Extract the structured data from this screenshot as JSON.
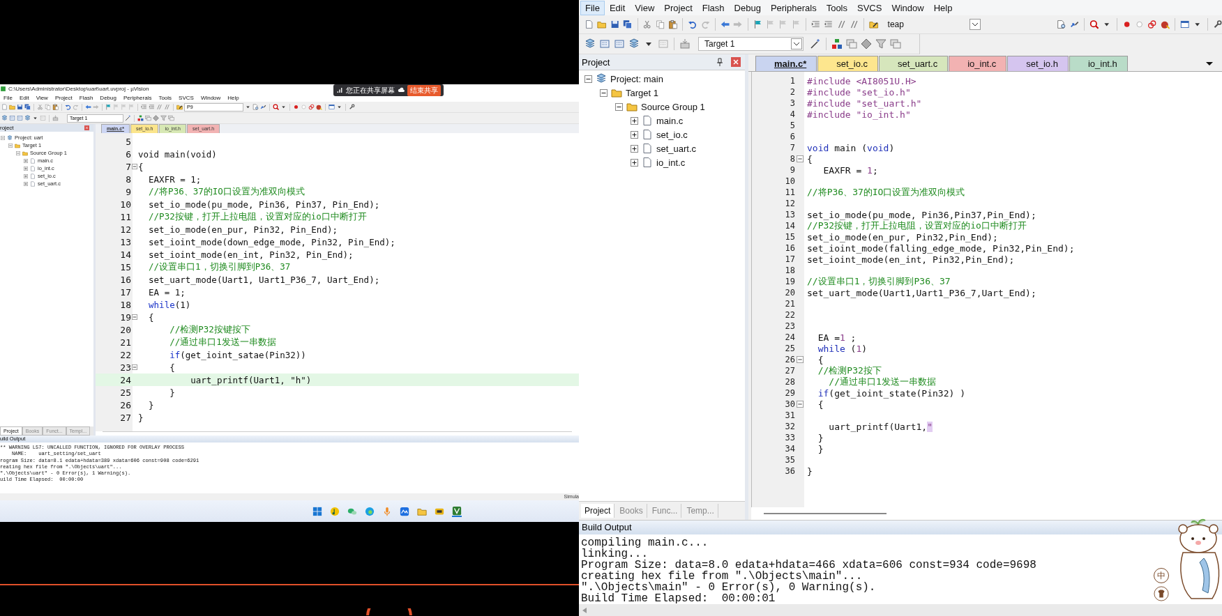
{
  "screen_share": {
    "window_title": "C:\\Users\\Administrator\\Desktop\\uart\\uart.uvproj - µVision",
    "share_banner": {
      "text": "您正在共享屏幕",
      "button": "结束共享"
    },
    "menu": [
      {
        "label": "File"
      },
      {
        "label": "Edit"
      },
      {
        "label": "View"
      },
      {
        "label": "Project"
      },
      {
        "label": "Flash"
      },
      {
        "label": "Debug"
      },
      {
        "label": "Peripherals"
      },
      {
        "label": "Tools"
      },
      {
        "label": "SVCS"
      },
      {
        "label": "Window"
      },
      {
        "label": "Help"
      }
    ],
    "toolbar": {
      "find_combo": "P9",
      "target_combo": "Target 1"
    },
    "project_panel": {
      "title": "roject",
      "tree": [
        {
          "label": "Project: uart",
          "expanded": true,
          "children": [
            {
              "label": "Target 1",
              "expanded": true,
              "children": [
                {
                  "label": "Source Group 1",
                  "expanded": true,
                  "children": [
                    {
                      "label": "main.c",
                      "expanded": false
                    },
                    {
                      "label": "io_int.c",
                      "expanded": false
                    },
                    {
                      "label": "set_io.c",
                      "expanded": false
                    },
                    {
                      "label": "set_uart.c",
                      "expanded": false
                    }
                  ]
                }
              ]
            }
          ]
        }
      ]
    },
    "editor_tabs": [
      {
        "label": "main.c*",
        "selected": true,
        "color": "#cdd6f4"
      },
      {
        "label": "set_io.h",
        "selected": false,
        "color": "#fbe58c"
      },
      {
        "label": "io_int.h",
        "selected": false,
        "color": "#d7e8b4"
      },
      {
        "label": "set_uart.h",
        "selected": false,
        "color": "#f2b3b3"
      }
    ],
    "code": [
      {
        "n": "5",
        "fold": false,
        "current": false
      },
      {
        "n": "6",
        "fold": false,
        "current": false,
        "tokens": [
          {
            "text": "void main(void)",
            "kind": "tx"
          }
        ]
      },
      {
        "n": "7",
        "fold": true,
        "current": false,
        "tokens": [
          {
            "text": "{",
            "kind": "tx"
          }
        ]
      },
      {
        "n": "8",
        "fold": false,
        "current": false,
        "tokens": [
          {
            "text": "  EAXFR = 1;",
            "kind": "tx"
          }
        ]
      },
      {
        "n": "9",
        "fold": false,
        "current": false,
        "tokens": [
          {
            "text": "  //将P36、37的IO口设置为准双向模式",
            "kind": "cm"
          }
        ]
      },
      {
        "n": "10",
        "fold": false,
        "current": false,
        "tokens": [
          {
            "text": "  set_io_mode(pu_mode, Pin36, Pin37, Pin_End);",
            "kind": "tx"
          }
        ]
      },
      {
        "n": "11",
        "fold": false,
        "current": false,
        "tokens": [
          {
            "text": "  //P32按键，打开上拉电阻，设置对应的io口中断打开",
            "kind": "cm"
          }
        ]
      },
      {
        "n": "12",
        "fold": false,
        "current": false,
        "tokens": [
          {
            "text": "  set_io_mode(en_pur, Pin32, Pin_End);",
            "kind": "tx"
          }
        ]
      },
      {
        "n": "13",
        "fold": false,
        "current": false,
        "tokens": [
          {
            "text": "  set_ioint_mode(down_edge_mode, Pin32, Pin_End);",
            "kind": "tx"
          }
        ]
      },
      {
        "n": "14",
        "fold": false,
        "current": false,
        "tokens": [
          {
            "text": "  set_ioint_mode(en_int, Pin32, Pin_End);",
            "kind": "tx"
          }
        ]
      },
      {
        "n": "15",
        "fold": false,
        "current": false,
        "tokens": [
          {
            "text": "  //设置串口1，切换引脚到P36、37",
            "kind": "cm"
          }
        ]
      },
      {
        "n": "16",
        "fold": false,
        "current": false,
        "tokens": [
          {
            "text": "  set_uart_mode(Uart1, Uart1_P36_7, Uart_End);",
            "kind": "tx"
          }
        ]
      },
      {
        "n": "17",
        "fold": false,
        "current": false,
        "tokens": [
          {
            "text": "  EA = 1;",
            "kind": "tx"
          }
        ]
      },
      {
        "n": "18",
        "fold": false,
        "current": false,
        "tokens": [
          {
            "text": "  while",
            "kind": "kw"
          },
          {
            "text": "(1)",
            "kind": "tx"
          }
        ]
      },
      {
        "n": "19",
        "fold": true,
        "current": false,
        "tokens": [
          {
            "text": "  {",
            "kind": "tx"
          }
        ]
      },
      {
        "n": "20",
        "fold": false,
        "current": false,
        "tokens": [
          {
            "text": "      //检测P32按键按下",
            "kind": "cm"
          }
        ]
      },
      {
        "n": "21",
        "fold": false,
        "current": false,
        "tokens": [
          {
            "text": "      //通过串口1发送一串数据",
            "kind": "cm"
          }
        ]
      },
      {
        "n": "22",
        "fold": false,
        "current": false,
        "tokens": [
          {
            "text": "      if",
            "kind": "kw"
          },
          {
            "text": "(get_ioint_satae(Pin32))",
            "kind": "tx"
          }
        ]
      },
      {
        "n": "23",
        "fold": true,
        "current": false,
        "tokens": [
          {
            "text": "      {",
            "kind": "tx"
          }
        ]
      },
      {
        "n": "24",
        "fold": false,
        "current": true,
        "tokens": [
          {
            "text": "          uart_printf(Uart1, \"h\")",
            "kind": "tx"
          }
        ]
      },
      {
        "n": "25",
        "fold": false,
        "current": false,
        "tokens": [
          {
            "text": "      }",
            "kind": "tx"
          }
        ]
      },
      {
        "n": "26",
        "fold": false,
        "current": false,
        "tokens": [
          {
            "text": "  }",
            "kind": "tx"
          }
        ]
      },
      {
        "n": "27",
        "fold": false,
        "current": false,
        "tokens": [
          {
            "text": "}",
            "kind": "tx"
          }
        ]
      }
    ],
    "panel_tabs": [
      {
        "label": "Project",
        "selected": true
      },
      {
        "label": "Books",
        "selected": false
      },
      {
        "label": "Funct...",
        "selected": false
      },
      {
        "label": "Templ...",
        "selected": false
      }
    ],
    "build_output": {
      "title": "uild Output",
      "lines": [
        "** WARNING L57: UNCALLED FUNCTION, IGNORED FOR OVERLAY PROCESS",
        "    NAME:    uart_setting/set_uart",
        "rogram Size: data=8.1 edata+hdata=389 xdata=606 const=908 code=6291",
        "reating hex file from \".\\Objects\\uart\"...",
        "\".\\Objects\\uart\" - 0 Error(s), 1 Warning(s).",
        "uild Time Elapsed:  00:00:00"
      ]
    },
    "status_bar": "Simula"
  },
  "ide": {
    "menu": [
      {
        "label": "File",
        "selected": true
      },
      {
        "label": "Edit",
        "selected": false
      },
      {
        "label": "View",
        "selected": false
      },
      {
        "label": "Project",
        "selected": false
      },
      {
        "label": "Flash",
        "selected": false
      },
      {
        "label": "Debug",
        "selected": false
      },
      {
        "label": "Peripherals",
        "selected": false
      },
      {
        "label": "Tools",
        "selected": false
      },
      {
        "label": "SVCS",
        "selected": false
      },
      {
        "label": "Window",
        "selected": false
      },
      {
        "label": "Help",
        "selected": false
      }
    ],
    "toolbar": {
      "find_combo": "teap",
      "target_combo": "Target 1"
    },
    "project_panel": {
      "title": "Project",
      "tree": [
        {
          "label": "Project: main",
          "expanded": true,
          "children": [
            {
              "label": "Target 1",
              "expanded": true,
              "children": [
                {
                  "label": "Source Group 1",
                  "expanded": true,
                  "children": [
                    {
                      "label": "main.c",
                      "expanded": false
                    },
                    {
                      "label": "set_io.c",
                      "expanded": false
                    },
                    {
                      "label": "set_uart.c",
                      "expanded": false
                    },
                    {
                      "label": "io_int.c",
                      "expanded": false
                    }
                  ]
                }
              ]
            }
          ]
        }
      ]
    },
    "editor_tabs": [
      {
        "label": "main.c*",
        "selected": true,
        "color": "#c9d4f0"
      },
      {
        "label": "set_io.c",
        "selected": false,
        "color": "#fde68e"
      },
      {
        "label": "set_uart.c",
        "selected": false,
        "color": "#d6e6bc"
      },
      {
        "label": "io_int.c",
        "selected": false,
        "color": "#f2b2b2"
      },
      {
        "label": "set_io.h",
        "selected": false,
        "color": "#d5c5ef"
      },
      {
        "label": "io_int.h",
        "selected": false,
        "color": "#b9dcc8"
      }
    ],
    "code": [
      {
        "n": "1",
        "fold": false,
        "tokens": [
          {
            "text": "#include <AI8051U.H>",
            "kind": "pp"
          }
        ]
      },
      {
        "n": "2",
        "fold": false,
        "tokens": [
          {
            "text": "#include \"set_io.h\"",
            "kind": "pp"
          }
        ]
      },
      {
        "n": "3",
        "fold": false,
        "tokens": [
          {
            "text": "#include \"set_uart.h\"",
            "kind": "pp"
          }
        ]
      },
      {
        "n": "4",
        "fold": false,
        "tokens": [
          {
            "text": "#include \"io_int.h\"",
            "kind": "pp"
          }
        ]
      },
      {
        "n": "5",
        "fold": false
      },
      {
        "n": "6",
        "fold": false
      },
      {
        "n": "7",
        "fold": false,
        "tokens": [
          {
            "text": "void",
            "kind": "kw"
          },
          {
            "text": " main (",
            "kind": "tx"
          },
          {
            "text": "void",
            "kind": "kw"
          },
          {
            "text": ")",
            "kind": "tx"
          }
        ]
      },
      {
        "n": "8",
        "fold": true,
        "tokens": [
          {
            "text": "{",
            "kind": "tx"
          }
        ]
      },
      {
        "n": "9",
        "fold": false,
        "tokens": [
          {
            "text": "   EAXFR = ",
            "kind": "tx"
          },
          {
            "text": "1",
            "kind": "num"
          },
          {
            "text": ";",
            "kind": "tx"
          }
        ]
      },
      {
        "n": "10",
        "fold": false
      },
      {
        "n": "11",
        "fold": false,
        "tokens": [
          {
            "text": "//将P36、37的IO口设置为准双向模式",
            "kind": "cm"
          }
        ]
      },
      {
        "n": "12",
        "fold": false
      },
      {
        "n": "13",
        "fold": false,
        "tokens": [
          {
            "text": "set_io_mode(pu_mode, Pin36,Pin37,Pin_End);",
            "kind": "tx"
          }
        ]
      },
      {
        "n": "14",
        "fold": false,
        "tokens": [
          {
            "text": "//P32按键，打开上拉电阻，设置对应的io口中断打开",
            "kind": "cm"
          }
        ]
      },
      {
        "n": "15",
        "fold": false,
        "tokens": [
          {
            "text": "set_io_mode(en_pur, Pin32,Pin_End);",
            "kind": "tx"
          }
        ]
      },
      {
        "n": "16",
        "fold": false,
        "tokens": [
          {
            "text": "set_ioint_mode(falling_edge_mode, Pin32,Pin_End);",
            "kind": "tx"
          }
        ]
      },
      {
        "n": "17",
        "fold": false,
        "tokens": [
          {
            "text": "set_ioint_mode(en_int, Pin32,Pin_End);",
            "kind": "tx"
          }
        ]
      },
      {
        "n": "18",
        "fold": false
      },
      {
        "n": "19",
        "fold": false,
        "tokens": [
          {
            "text": "//设置串口1，切换引脚到P36、37",
            "kind": "cm"
          }
        ]
      },
      {
        "n": "20",
        "fold": false,
        "tokens": [
          {
            "text": "set_uart_mode(Uart1,Uart1_P36_7,Uart_End);",
            "kind": "tx"
          }
        ]
      },
      {
        "n": "21",
        "fold": false
      },
      {
        "n": "22",
        "fold": false
      },
      {
        "n": "23",
        "fold": false
      },
      {
        "n": "24",
        "fold": false,
        "tokens": [
          {
            "text": "  EA =",
            "kind": "tx"
          },
          {
            "text": "1",
            "kind": "num"
          },
          {
            "text": " ;",
            "kind": "tx"
          }
        ]
      },
      {
        "n": "25",
        "fold": false,
        "tokens": [
          {
            "text": "  while",
            "kind": "kw"
          },
          {
            "text": " (",
            "kind": "tx"
          },
          {
            "text": "1",
            "kind": "num"
          },
          {
            "text": ")",
            "kind": "tx"
          }
        ]
      },
      {
        "n": "26",
        "fold": true,
        "tokens": [
          {
            "text": "  {",
            "kind": "tx"
          }
        ]
      },
      {
        "n": "27",
        "fold": false,
        "tokens": [
          {
            "text": "  //检测P32按下",
            "kind": "cm"
          }
        ]
      },
      {
        "n": "28",
        "fold": false,
        "tokens": [
          {
            "text": "    //通过串口1发送一串数据",
            "kind": "cm"
          }
        ]
      },
      {
        "n": "29",
        "fold": false,
        "tokens": [
          {
            "text": "  if",
            "kind": "kw"
          },
          {
            "text": "(get_ioint_state(Pin32) )",
            "kind": "tx"
          }
        ]
      },
      {
        "n": "30",
        "fold": true,
        "tokens": [
          {
            "text": "  {",
            "kind": "tx"
          }
        ]
      },
      {
        "n": "31",
        "fold": false
      },
      {
        "n": "32",
        "fold": false,
        "tokens": [
          {
            "text": "    uart_printf(Uart1,",
            "kind": "tx"
          },
          {
            "text": "\"",
            "kind": "match"
          }
        ]
      },
      {
        "n": "33",
        "fold": false,
        "tokens": [
          {
            "text": "  }",
            "kind": "tx"
          }
        ]
      },
      {
        "n": "34",
        "fold": false,
        "tokens": [
          {
            "text": "  }",
            "kind": "tx"
          }
        ]
      },
      {
        "n": "35",
        "fold": false
      },
      {
        "n": "36",
        "fold": false,
        "tokens": [
          {
            "text": "}",
            "kind": "tx"
          }
        ]
      }
    ],
    "panel_tabs": [
      {
        "label": "Project",
        "selected": true
      },
      {
        "label": "Books",
        "selected": false
      },
      {
        "label": "Func...",
        "selected": false
      },
      {
        "label": "Temp...",
        "selected": false
      }
    ],
    "build_output": {
      "title": "Build Output",
      "lines": [
        "compiling main.c...",
        "linking...",
        "Program Size: data=8.0 edata+hdata=466 xdata=606 const=934 code=9698",
        "creating hex file from \".\\Objects\\main\"...",
        "\".\\Objects\\main\" - 0 Error(s), 0 Warning(s).",
        "Build Time Elapsed:  00:00:01"
      ]
    },
    "ime_button": "中"
  }
}
